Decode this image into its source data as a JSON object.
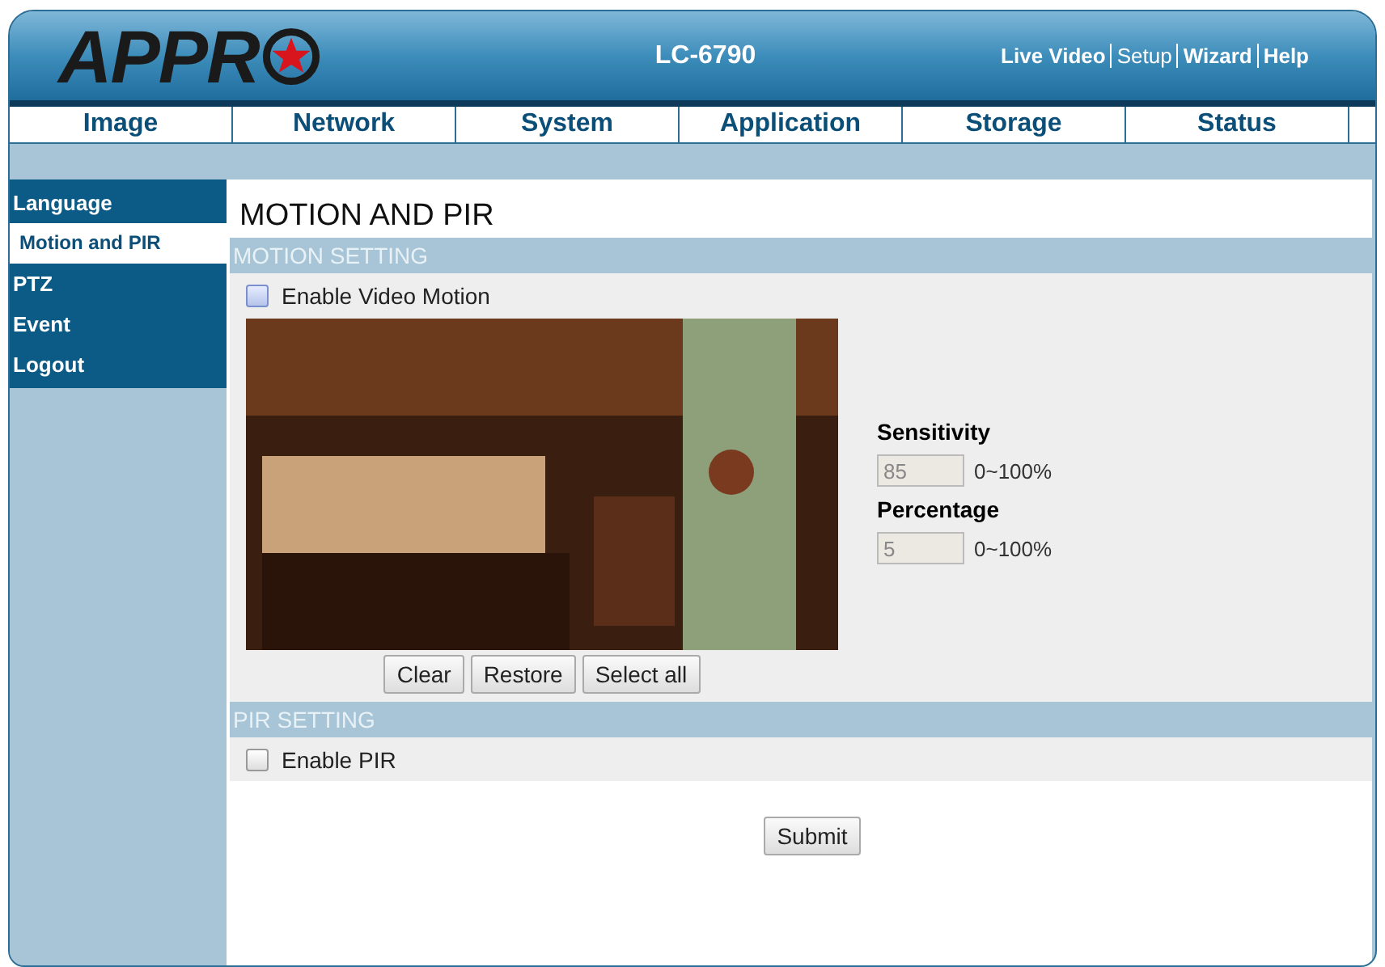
{
  "header": {
    "logo": "APPR",
    "model": "LC-6790",
    "links": [
      {
        "label": "Live Video",
        "selected": false
      },
      {
        "label": "Setup",
        "selected": true
      },
      {
        "label": "Wizard",
        "selected": false
      },
      {
        "label": "Help",
        "selected": false
      }
    ]
  },
  "tabs": [
    {
      "label": "Image",
      "selected": false
    },
    {
      "label": "Network",
      "selected": false
    },
    {
      "label": "System",
      "selected": false
    },
    {
      "label": "Application",
      "selected": false
    },
    {
      "label": "Storage",
      "selected": false
    },
    {
      "label": "Status",
      "selected": false
    }
  ],
  "sidebar": {
    "items": [
      {
        "label": "Language",
        "selected": false
      },
      {
        "label": "Motion and PIR",
        "selected": true
      },
      {
        "label": "PTZ",
        "selected": false
      },
      {
        "label": "Event",
        "selected": false
      },
      {
        "label": "Logout",
        "selected": false
      }
    ]
  },
  "page_title": "MOTION AND PIR",
  "motion": {
    "heading": "MOTION SETTING",
    "enable": {
      "label": "Enable Video Motion",
      "checked": false
    },
    "fields": [
      {
        "label": "Sensitivity",
        "value": "85",
        "range": "0~100%",
        "disabled": true
      },
      {
        "label": "Percentage",
        "value": "5",
        "range": "0~100%",
        "disabled": true
      }
    ],
    "buttons": [
      "Clear",
      "Restore",
      "Select all"
    ]
  },
  "pir": {
    "heading": "PIR SETTING",
    "enable": {
      "label": "Enable PIR",
      "checked": false
    }
  },
  "submit": "Submit"
}
